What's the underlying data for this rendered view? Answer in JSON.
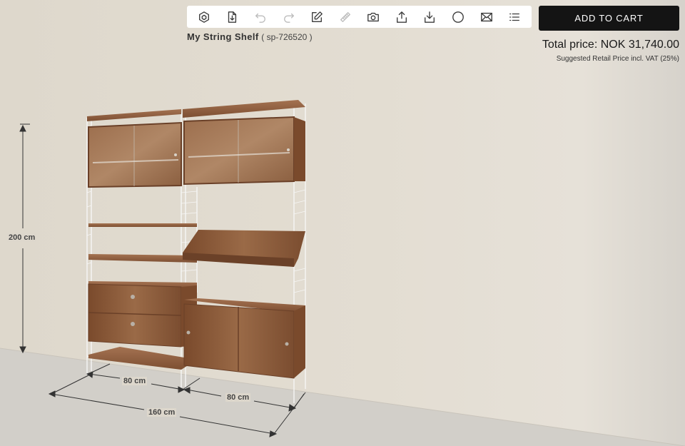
{
  "toolbar": {
    "tools": [
      {
        "icon": "cube-icon",
        "enabled": true
      },
      {
        "icon": "file-download-icon",
        "enabled": true
      },
      {
        "icon": "undo-icon",
        "enabled": false
      },
      {
        "icon": "redo-icon",
        "enabled": false
      },
      {
        "icon": "edit-icon",
        "enabled": true
      },
      {
        "icon": "ruler-icon",
        "enabled": false
      },
      {
        "icon": "camera-icon",
        "enabled": true
      },
      {
        "icon": "share-icon",
        "enabled": true
      },
      {
        "icon": "download-icon",
        "enabled": true
      },
      {
        "icon": "circle-icon",
        "enabled": true
      },
      {
        "icon": "mail-icon",
        "enabled": true
      },
      {
        "icon": "list-icon",
        "enabled": true
      }
    ]
  },
  "cart": {
    "label": "ADD TO CART"
  },
  "product": {
    "name": "My String Shelf",
    "code_open": "( ",
    "code": "sp-726520",
    "code_close": " )"
  },
  "price": {
    "total": "Total price: NOK 31,740.00",
    "note": "Suggested Retail Price incl. VAT (25%)"
  },
  "dimensions": {
    "height": "200 cm",
    "width_left": "80 cm",
    "width_right": "80 cm",
    "width_total": "160 cm"
  },
  "colors": {
    "wall": "#e2dcd1",
    "floor": "#d3d0cb",
    "wood": "#8a5a3a",
    "wood_dark": "#6b4128",
    "frame": "#f4f4f4",
    "button": "#141414"
  }
}
